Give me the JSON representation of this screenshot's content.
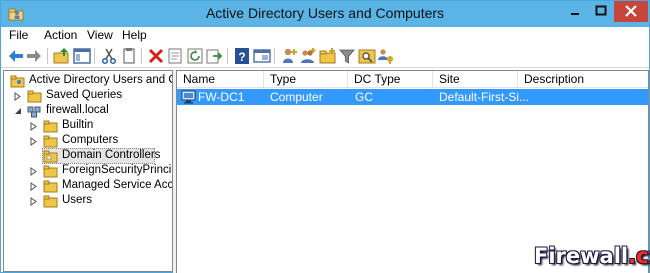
{
  "window": {
    "title": "Active Directory Users and Computers"
  },
  "menu": [
    "File",
    "Action",
    "View",
    "Help"
  ],
  "toolbar": {
    "buttons": [
      "back-icon",
      "forward-icon",
      "up-folder-icon",
      "show-tree-icon",
      "cut-icon",
      "copy-icon",
      "delete-icon",
      "properties-icon",
      "refresh-icon",
      "export-icon",
      "help-icon",
      "console-icon",
      "add-user-icon",
      "add-group-icon",
      "add-ou-icon",
      "filter-icon",
      "find-icon",
      "delegate-icon"
    ]
  },
  "tree": {
    "root": "Active Directory Users and Com",
    "items": [
      {
        "label": "Saved Queries"
      },
      {
        "label": "firewall.local"
      },
      {
        "label": "Builtin"
      },
      {
        "label": "Computers"
      },
      {
        "label": "Domain Controllers"
      },
      {
        "label": "ForeignSecurityPrincipals"
      },
      {
        "label": "Managed Service Accour"
      },
      {
        "label": "Users"
      }
    ]
  },
  "list": {
    "columns": [
      "Name",
      "Type",
      "DC Type",
      "Site",
      "Description"
    ],
    "rows": [
      {
        "name": "FW-DC1",
        "type": "Computer",
        "dc_type": "GC",
        "site": "Default-First-Si...",
        "description": ""
      }
    ]
  },
  "watermark": {
    "main": "Firewall",
    "suffix": ".cx"
  },
  "colors": {
    "titlebar": "#5ab4e6",
    "close": "#c7463b",
    "selection": "#3399ff"
  }
}
